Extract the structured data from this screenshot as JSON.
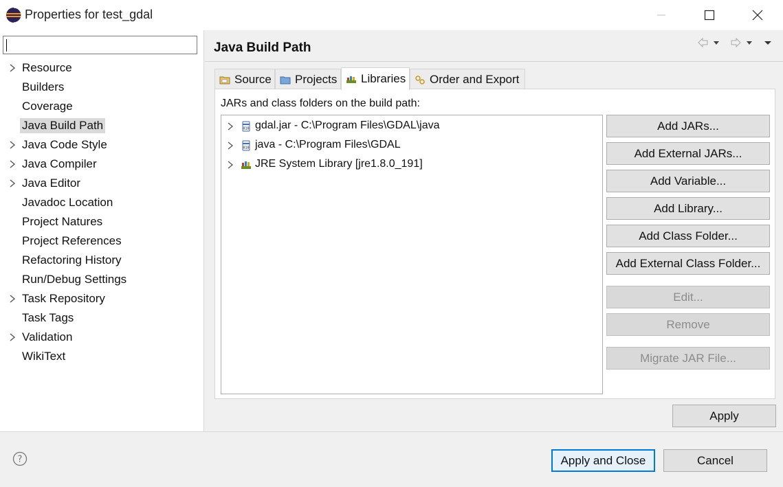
{
  "window": {
    "title": "Properties for test_gdal",
    "icon": "eclipse-icon"
  },
  "sidebar": {
    "filter_value": "",
    "items": [
      {
        "label": "Resource",
        "expandable": true
      },
      {
        "label": "Builders",
        "expandable": false
      },
      {
        "label": "Coverage",
        "expandable": false
      },
      {
        "label": "Java Build Path",
        "expandable": false,
        "selected": true
      },
      {
        "label": "Java Code Style",
        "expandable": true
      },
      {
        "label": "Java Compiler",
        "expandable": true
      },
      {
        "label": "Java Editor",
        "expandable": true
      },
      {
        "label": "Javadoc Location",
        "expandable": false
      },
      {
        "label": "Project Natures",
        "expandable": false
      },
      {
        "label": "Project References",
        "expandable": false
      },
      {
        "label": "Refactoring History",
        "expandable": false
      },
      {
        "label": "Run/Debug Settings",
        "expandable": false
      },
      {
        "label": "Task Repository",
        "expandable": true
      },
      {
        "label": "Task Tags",
        "expandable": false
      },
      {
        "label": "Validation",
        "expandable": true
      },
      {
        "label": "WikiText",
        "expandable": false
      }
    ]
  },
  "page": {
    "title": "Java Build Path"
  },
  "tabs": [
    {
      "label": "Source",
      "icon": "source-folder-icon",
      "active": false
    },
    {
      "label": "Projects",
      "icon": "projects-icon",
      "active": false
    },
    {
      "label": "Libraries",
      "icon": "libraries-icon",
      "active": true
    },
    {
      "label": "Order and Export",
      "icon": "order-export-icon",
      "active": false
    }
  ],
  "libraries": {
    "heading": "JARs and class folders on the build path:",
    "entries": [
      {
        "label": "gdal.jar - C:\\Program Files\\GDAL\\java",
        "icon": "jar-icon"
      },
      {
        "label": "java - C:\\Program Files\\GDAL",
        "icon": "jar-icon"
      },
      {
        "label": "JRE System Library [jre1.8.0_191]",
        "icon": "jre-library-icon"
      }
    ]
  },
  "buttons": {
    "add_jars": "Add JARs...",
    "add_external_jars": "Add External JARs...",
    "add_variable": "Add Variable...",
    "add_library": "Add Library...",
    "add_class_folder": "Add Class Folder...",
    "add_external_class_folder": "Add External Class Folder...",
    "edit": "Edit...",
    "remove": "Remove",
    "migrate_jar": "Migrate JAR File...",
    "apply": "Apply",
    "apply_and_close": "Apply and Close",
    "cancel": "Cancel"
  },
  "colors": {
    "accent": "#0078d7",
    "selection": "#d9d9d9"
  }
}
